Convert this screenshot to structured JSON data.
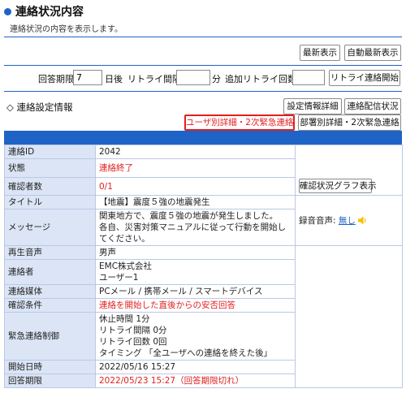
{
  "header": {
    "title": "連絡状況内容",
    "subtitle": "連絡状況の内容を表示します。"
  },
  "toolbar": {
    "latest": "最新表示",
    "auto_latest": "自動最新表示"
  },
  "retry": {
    "deadline_label": "回答期限",
    "deadline_value": "7",
    "days_after": "日後",
    "interval_label": "リトライ間隔",
    "interval_value": "",
    "minutes": "分",
    "additional_label": "追加リトライ回数",
    "additional_value": "",
    "start_button": "リトライ連絡開始"
  },
  "section": {
    "title": "◇ 連絡設定情報",
    "detail_button": "設定情報詳細",
    "delivery_button": "連絡配信状況",
    "user_detail_button": "ユーザ別詳細・2次緊急連絡",
    "dept_detail_button": "部署別詳細・2次緊急連絡"
  },
  "info": {
    "id_label": "連絡ID",
    "id_value": "2042",
    "status_label": "状態",
    "status_value": "連絡終了",
    "confirmed_label": "確認者数",
    "confirmed_value": "0/1",
    "graph_button": "確認状況グラフ表示",
    "subject_label": "タイトル",
    "subject_value": "【地震】震度５強の地震発生",
    "message_label": "メッセージ",
    "message_line1": "関東地方で、震度５強の地震が発生しました。",
    "message_line2": "各自、災害対策マニュアルに従って行動を開始してください。",
    "recorded_audio": "録音音声:",
    "none_link": "無し",
    "voice_label": "再生音声",
    "voice_value": "男声",
    "contact_label": "連絡者",
    "contact_company": "EMC株式会社",
    "contact_user": "ユーザー1",
    "media_label": "連絡媒体",
    "media_value": "PCメール / 携帯メール / スマートデバイス",
    "condition_label": "確認条件",
    "condition_value": "連絡を開始した直後からの安否回答",
    "emergency_label": "緊急連絡制御",
    "emergency_line1": "休止時間 1分",
    "emergency_line2": "リトライ間隔 0分",
    "emergency_line3": "リトライ回数 0回",
    "emergency_line4": "タイミング 「全ユーザへの連絡を終えた後」",
    "start_label": "開始日時",
    "start_value": "2022/05/16 15:27",
    "deadline_label": "回答期限",
    "deadline_value": "2022/05/23 15:27（回答期限切れ）"
  },
  "colors": {
    "accent": "#1f63c6",
    "label_bg": "#dbe5f5",
    "alert": "#e02020"
  }
}
